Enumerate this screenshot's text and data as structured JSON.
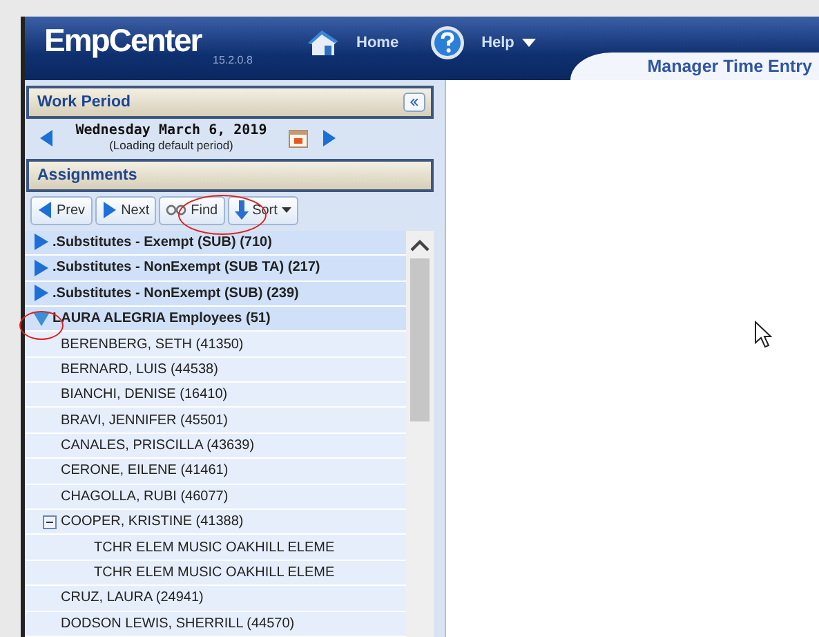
{
  "header": {
    "logo": "EmpCenter",
    "version": "15.2.0.8",
    "nav": [
      {
        "label": "Home",
        "kind": "home"
      },
      {
        "label": "Help",
        "kind": "help"
      }
    ],
    "page_tab": "Manager Time Entry"
  },
  "work_period": {
    "title": "Work Period",
    "date": "Wednesday March 6, 2019",
    "note": "(Loading default period)"
  },
  "assignments": {
    "title": "Assignments",
    "toolbar": [
      {
        "label": "Prev",
        "kind": "prev"
      },
      {
        "label": "Next",
        "kind": "next"
      },
      {
        "label": "Find",
        "kind": "find"
      },
      {
        "label": "Sort",
        "kind": "sort"
      }
    ],
    "tree": [
      {
        "label": ".Substitutes - Exempt (SUB) (710)",
        "expanded": false
      },
      {
        "label": ".Substitutes - NonExempt (SUB TA) (217)",
        "expanded": false
      },
      {
        "label": ".Substitutes - NonExempt (SUB) (239)",
        "expanded": false
      },
      {
        "label": "LAURA ALEGRIA Employees (51)",
        "expanded": true,
        "children": [
          {
            "label": "BERENBERG, SETH (41350)"
          },
          {
            "label": "BERNARD, LUIS (44538)"
          },
          {
            "label": "BIANCHI, DENISE (16410)"
          },
          {
            "label": "BRAVI, JENNIFER (45501)"
          },
          {
            "label": "CANALES, PRISCILLA (43639)"
          },
          {
            "label": "CERONE, EILENE (41461)"
          },
          {
            "label": "CHAGOLLA, RUBI (46077)"
          },
          {
            "label": "COOPER, KRISTINE (41388)",
            "expanded": true,
            "children": [
              {
                "label": "TCHR ELEM MUSIC OAKHILL ELEME"
              },
              {
                "label": "TCHR ELEM MUSIC OAKHILL ELEME"
              }
            ]
          },
          {
            "label": "CRUZ, LAURA (24941)"
          },
          {
            "label": "DODSON LEWIS, SHERRILL (44570)"
          }
        ]
      }
    ]
  }
}
